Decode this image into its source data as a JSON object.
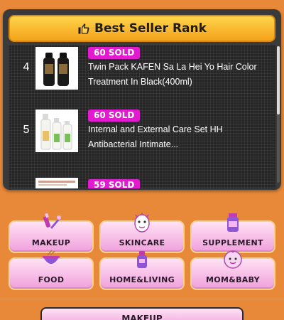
{
  "header": {
    "title": "Best Seller Rank"
  },
  "ranks": [
    {
      "rank": "4",
      "sold": "60  SOLD",
      "name": "Twin Pack KAFEN Sa La Hei Yo Hair Color Treatment In Black(400ml)",
      "image": "black-hair-color-bottles"
    },
    {
      "rank": "5",
      "sold": "60  SOLD",
      "name": "Internal and External Care Set HH Antibacterial Intimate...",
      "image": "white-care-bottles"
    },
    {
      "rank": "",
      "sold": "59  SOLD",
      "name": "",
      "image": "product-thumbnail"
    }
  ],
  "categories": [
    {
      "label": "MAKEUP",
      "icon": "makeup-icon"
    },
    {
      "label": "SKINCARE",
      "icon": "face-mask-icon"
    },
    {
      "label": "SUPPLEMENT",
      "icon": "supplement-jar-icon"
    },
    {
      "label": "FOOD",
      "icon": "food-bowl-icon"
    },
    {
      "label": "HOME&LIVING",
      "icon": "home-living-icon"
    },
    {
      "label": "MOM&BABY",
      "icon": "baby-face-icon"
    }
  ],
  "bottom_tab": {
    "label": "MAKEUP"
  },
  "colors": {
    "background": "#e8893a",
    "panel": "#3a3a3a",
    "header_gold": "#ffd54a",
    "sold_badge": "#e21bd0",
    "category_pink": "#f0a0dc"
  }
}
